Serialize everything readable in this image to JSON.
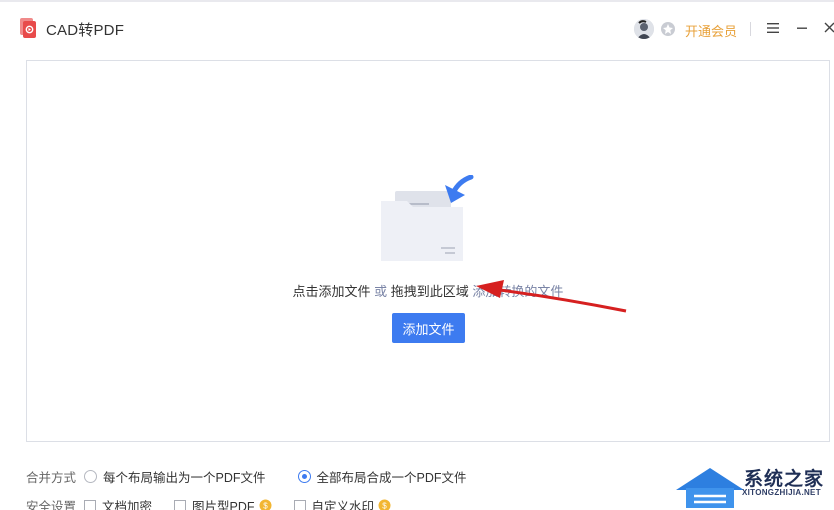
{
  "app": {
    "title": "CAD转PDF",
    "brand_color": "#e84b4b",
    "accent_color": "#3d7bf0"
  },
  "titlebar": {
    "avatar_icon": "avatar-icon",
    "vip_label": "开通会员",
    "vip_color": "#e8a13a",
    "menu_icon": "hamburger-icon",
    "min_icon": "minimize-icon",
    "close_icon": "close-icon"
  },
  "dropzone": {
    "text_part1": "点击添加文件",
    "text_or": " 或 ",
    "text_part2": "拖拽到此区域",
    "text_part3": " 添加转换的文件",
    "add_button_label": "添加文件"
  },
  "options": {
    "merge_label": "合并方式",
    "merge_options": [
      {
        "label": "每个布局输出为一个PDF文件",
        "selected": false
      },
      {
        "label": "全部布局合成一个PDF文件",
        "selected": true
      }
    ],
    "security_label": "安全设置",
    "security_options": [
      {
        "label": "文档加密",
        "checked": false,
        "vip": false
      },
      {
        "label": "图片型PDF",
        "checked": false,
        "vip": true
      },
      {
        "label": "自定义水印",
        "checked": false,
        "vip": true
      }
    ]
  },
  "watermark": {
    "line1": "系统之家",
    "line2": "XITONGZHIJIA.NET"
  }
}
